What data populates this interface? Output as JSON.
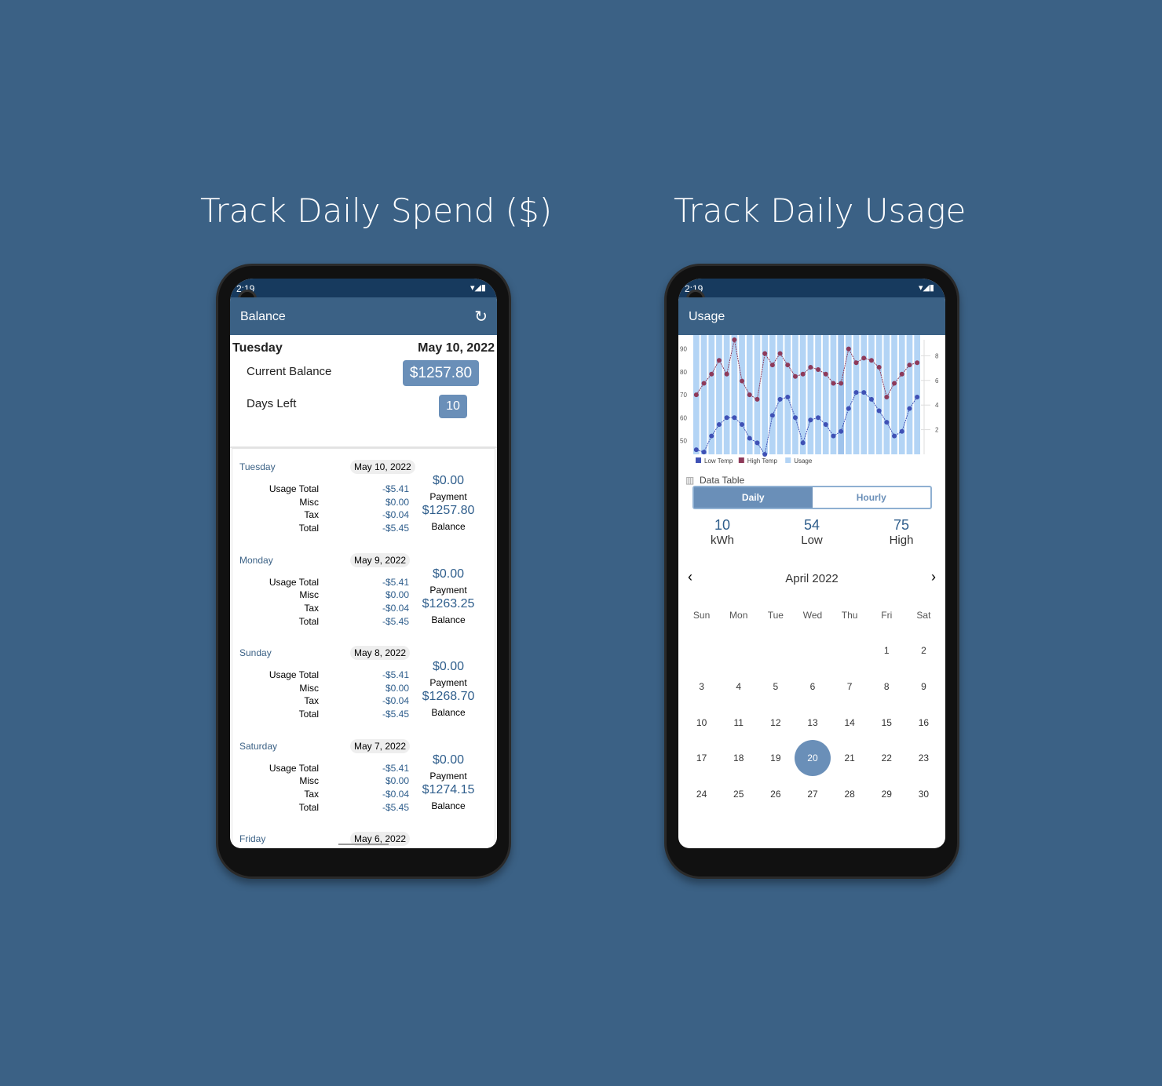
{
  "left": {
    "heading": "Track Daily Spend ($)",
    "status_time": "2:19",
    "status_icons": "▾◢▮",
    "title": "Balance",
    "summary": {
      "day": "Tuesday",
      "date": "May 10, 2022",
      "balance_label": "Current Balance",
      "balance": "$1257.80",
      "days_label": "Days Left",
      "days": "10"
    },
    "labels": [
      "Usage Total",
      "Misc",
      "Tax",
      "Total"
    ],
    "payment_label": "Payment",
    "balance_label": "Balance",
    "entries": [
      {
        "day": "Tuesday",
        "date": "May 10, 2022",
        "vals": [
          "-$5.41",
          "$0.00",
          "-$0.04",
          "-$5.45"
        ],
        "payment": "$0.00",
        "balance": "$1257.80"
      },
      {
        "day": "Monday",
        "date": "May 9, 2022",
        "vals": [
          "-$5.41",
          "$0.00",
          "-$0.04",
          "-$5.45"
        ],
        "payment": "$0.00",
        "balance": "$1263.25"
      },
      {
        "day": "Sunday",
        "date": "May 8, 2022",
        "vals": [
          "-$5.41",
          "$0.00",
          "-$0.04",
          "-$5.45"
        ],
        "payment": "$0.00",
        "balance": "$1268.70"
      },
      {
        "day": "Saturday",
        "date": "May 7, 2022",
        "vals": [
          "-$5.41",
          "$0.00",
          "-$0.04",
          "-$5.45"
        ],
        "payment": "$0.00",
        "balance": "$1274.15"
      },
      {
        "day": "Friday",
        "date": "May 6, 2022"
      }
    ]
  },
  "right": {
    "heading": "Track Daily Usage",
    "status_time": "2:19",
    "status_icons": "▾◢▮",
    "title": "Usage",
    "data_table": "Data Table",
    "tabs": [
      "Daily",
      "Hourly"
    ],
    "active_tab": "Daily",
    "stats": [
      {
        "value": "10",
        "label": "kWh"
      },
      {
        "value": "54",
        "label": "Low"
      },
      {
        "value": "75",
        "label": "High"
      }
    ],
    "month": "April 2022",
    "weekdays": [
      "Sun",
      "Mon",
      "Tue",
      "Wed",
      "Thu",
      "Fri",
      "Sat"
    ],
    "first_weekday": 5,
    "days_in_month": 30,
    "selected_day": 20
  },
  "chart_data": {
    "type": "line",
    "x": [
      1,
      2,
      3,
      4,
      5,
      6,
      7,
      8,
      9,
      10,
      11,
      12,
      13,
      14,
      15,
      16,
      17,
      18,
      19,
      20,
      21,
      22,
      23,
      24,
      25,
      26,
      27,
      28,
      29,
      30
    ],
    "series": [
      {
        "name": "Low Temp",
        "color": "#3f51b5",
        "values": [
          46,
          45,
          52,
          57,
          60,
          60,
          57,
          51,
          49,
          44,
          61,
          68,
          69,
          60,
          49,
          59,
          60,
          57,
          52,
          54,
          64,
          71,
          71,
          68,
          63,
          58,
          52,
          54,
          64,
          69
        ]
      },
      {
        "name": "High Temp",
        "color": "#8e3a5a",
        "values": [
          70,
          75,
          79,
          85,
          79,
          94,
          76,
          70,
          68,
          88,
          83,
          88,
          83,
          78,
          79,
          82,
          81,
          79,
          75,
          75,
          90,
          84,
          86,
          85,
          82,
          69,
          75,
          79,
          83,
          84
        ]
      },
      {
        "name": "Usage",
        "type": "bar",
        "axis": "right",
        "color": "#b3d4f5",
        "values": [
          10,
          10,
          10,
          10,
          10,
          10,
          10,
          10,
          10,
          10,
          10,
          10,
          10,
          10,
          10,
          10,
          10,
          10,
          10,
          10,
          10,
          10,
          10,
          10,
          10,
          10,
          10,
          10,
          10,
          10
        ]
      }
    ],
    "y_left_ticks": [
      50,
      60,
      70,
      80,
      90
    ],
    "y_right_ticks": [
      2,
      4,
      6,
      8
    ],
    "ylim_left": [
      44,
      94
    ],
    "ylim_right": [
      0,
      9.3
    ],
    "legend": "bottom-left",
    "grid": true
  }
}
